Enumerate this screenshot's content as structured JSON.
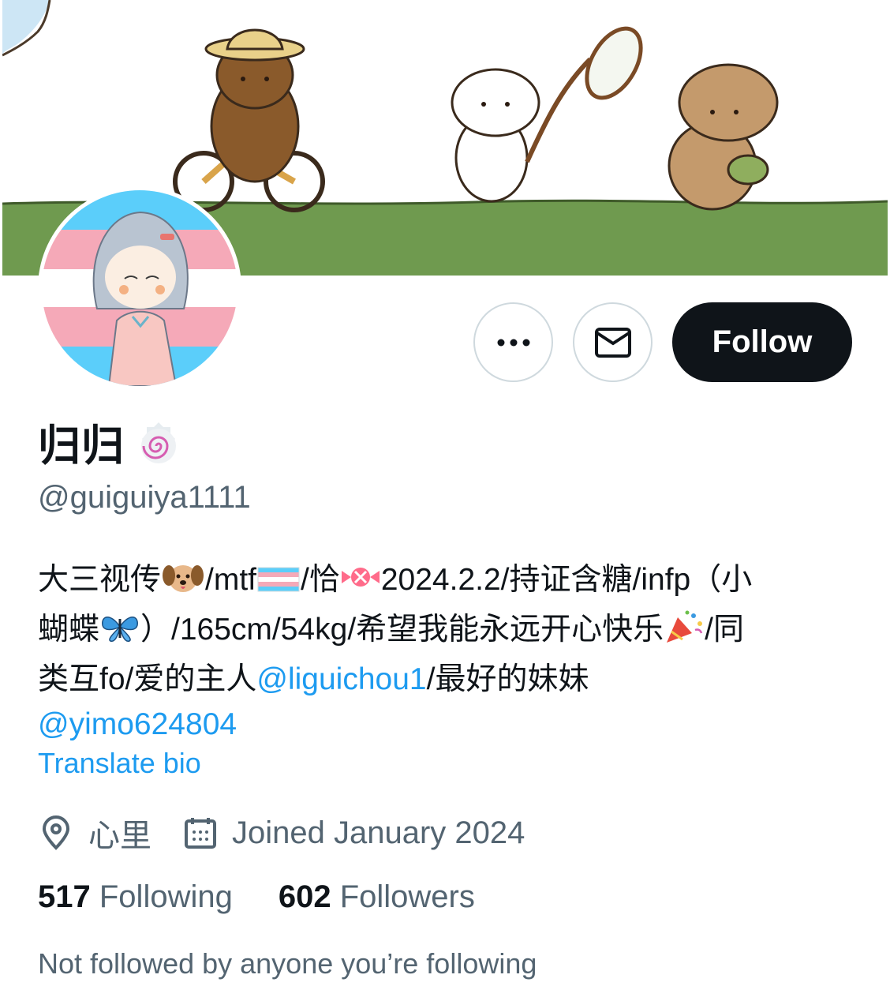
{
  "profile": {
    "display_name": "归归",
    "handle": "@guiguiya1111",
    "bio_segments": {
      "a": "大三视传",
      "b": "/mtf",
      "c": "/恰",
      "d": "2024.2.2/持证含糖/infp（小",
      "e": "蝴蝶",
      "f": "）/165cm/54kg/希望我能永远开心快乐",
      "g": "/同",
      "h": "类互fo/爱的主人",
      "mention1": "@liguichou1",
      "i": "/最好的妹妹",
      "mention2": "@yimo624804"
    },
    "translate_label": "Translate bio",
    "location": "心里",
    "joined": "Joined January 2024",
    "following_count": "517",
    "following_label": "Following",
    "followers_count": "602",
    "followers_label": "Followers",
    "not_followed": "Not followed by anyone you’re following"
  },
  "actions": {
    "more_icon": "more-horizontal-icon",
    "message_icon": "envelope-icon",
    "follow_label": "Follow"
  },
  "colors": {
    "text_primary": "#0f1419",
    "text_secondary": "#536471",
    "link": "#1d9bf0",
    "follow_bg": "#0f1419",
    "border": "#cfd9de"
  }
}
